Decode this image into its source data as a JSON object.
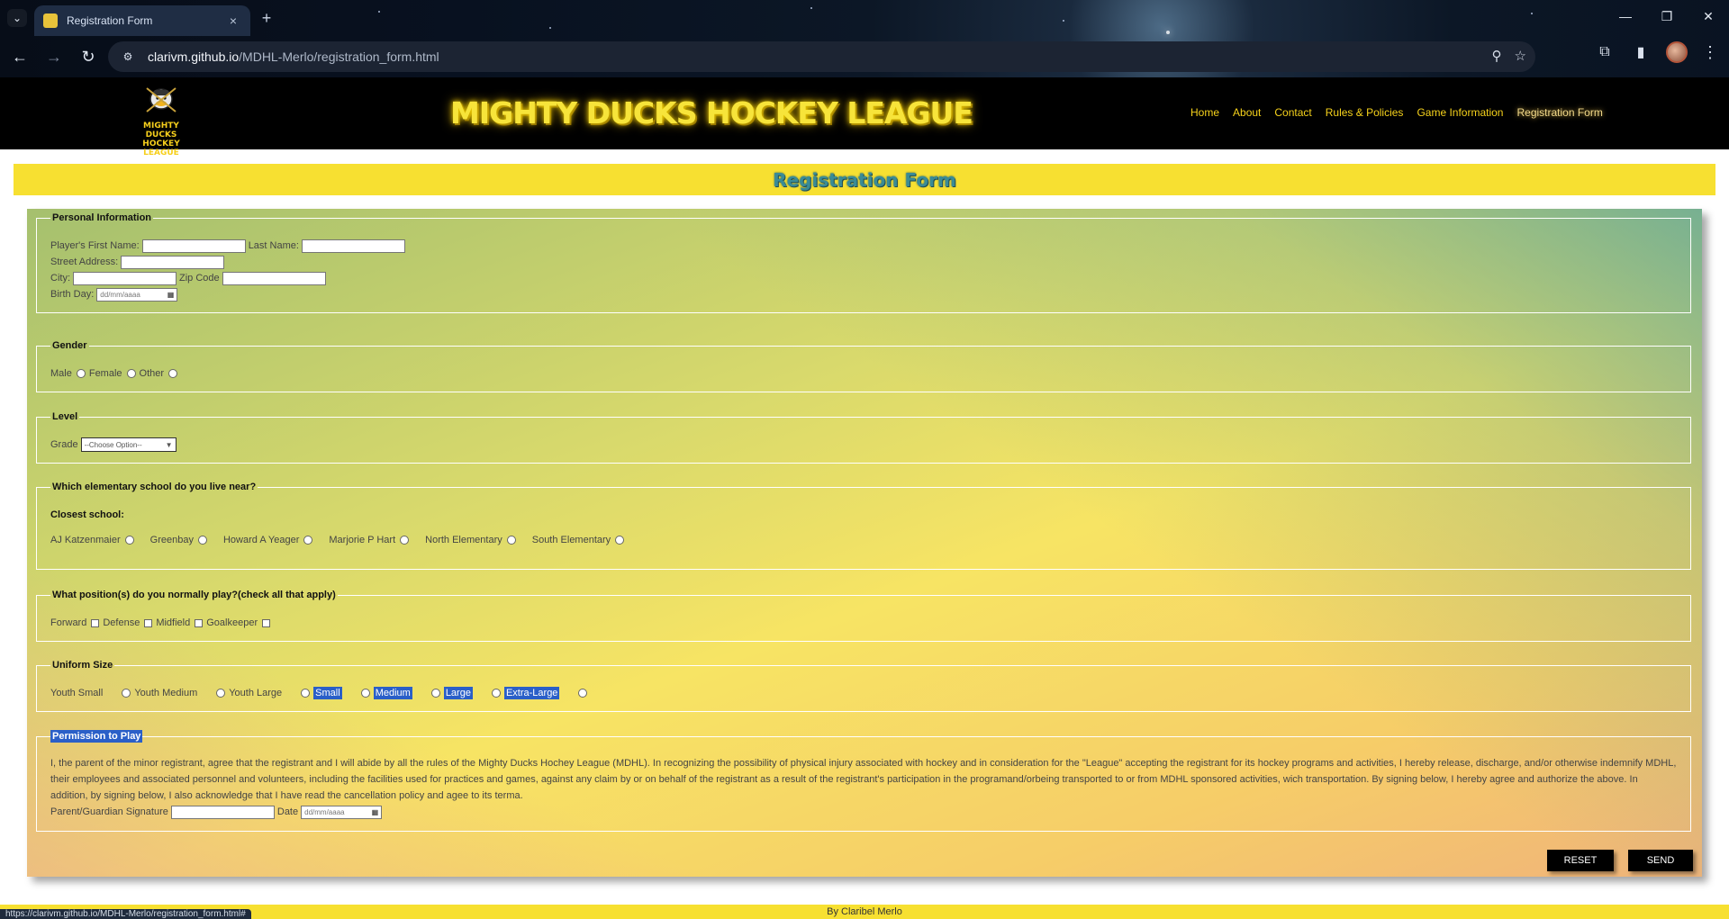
{
  "browser": {
    "tab_title": "Registration Form",
    "tab_close": "×",
    "new_tab": "+",
    "url_host": "clarivm.github.io",
    "url_path": "/MDHL-Merlo/registration_form.html",
    "status_url": "https://clarivm.github.io/MDHL-Merlo/registration_form.html#"
  },
  "header": {
    "logo_text_line1": "MIGHTY DUCKS",
    "logo_text_line2": "HOCKEY LEAGUE",
    "site_title": "MIGHTY DUCKS HOCKEY LEAGUE",
    "nav": [
      "Home",
      "About",
      "Contact",
      "Rules & Policies",
      "Game Information",
      "Registration Form"
    ],
    "active_nav": "Registration Form"
  },
  "page": {
    "heading": "Registration Form"
  },
  "personal": {
    "legend": "Personal Information",
    "first_name_label": "Player's First Name:",
    "last_name_label": "Last Name:",
    "street_label": "Street Address:",
    "city_label": "City:",
    "zip_label": "Zip Code",
    "birthday_label": "Birth Day:",
    "date_placeholder": "dd/mm/aaaa"
  },
  "gender": {
    "legend": "Gender",
    "options": [
      "Male",
      "Female",
      "Other"
    ]
  },
  "level": {
    "legend": "Level",
    "grade_label": "Grade",
    "grade_selected": "--Choose Option--"
  },
  "school": {
    "legend": "Which elementary school do you live near?",
    "closest_label": "Closest school:",
    "options": [
      "AJ Katzenmaier",
      "Greenbay",
      "Howard A Yeager",
      "Marjorie P Hart",
      "North Elementary",
      "South Elementary"
    ]
  },
  "position": {
    "legend": "What position(s) do you normally play?(check all that apply)",
    "options": [
      "Forward",
      "Defense",
      "Midfield",
      "Goalkeeper"
    ]
  },
  "uniform": {
    "legend": "Uniform Size",
    "options": [
      "Youth Small",
      "Youth Medium",
      "Youth Large",
      "Small",
      "Medium",
      "Large",
      "Extra-Large"
    ]
  },
  "permission": {
    "legend": "Permission to Play",
    "text": "I, the parent of the minor registrant, agree that the registrant and I will abide by all the rules of the Mighty Ducks Hochey League (MDHL). In recognizing the possibility of physical injury associated with hockey and in consideration for the \"League\" accepting the registrant for its hockey programs and activities, I hereby release, discharge, and/or otherwise indemnify MDHL, their employees and associated personnel and volunteers, including the facilities used for practices and games, against any claim by or on behalf of the registrant as a result of the registrant's participation in the programand/orbeing transported to or from MDHL sponsored activities, wich transportation. By signing below, I hereby agree and authorize the above. In addition, by signing below, I also acknowledge that I have read the cancellation policy and agee to its terma.",
    "signature_label": "Parent/Guardian Signature",
    "date_label": "Date",
    "date_placeholder": "dd/mm/aaaa"
  },
  "buttons": {
    "reset": "RESET",
    "send": "SEND"
  },
  "footer": {
    "text": "By Claribel Merlo"
  },
  "colors": {
    "brand_yellow": "#f7e031",
    "title_teal": "#3a8b96",
    "nav_yellow": "#f6d21b"
  }
}
